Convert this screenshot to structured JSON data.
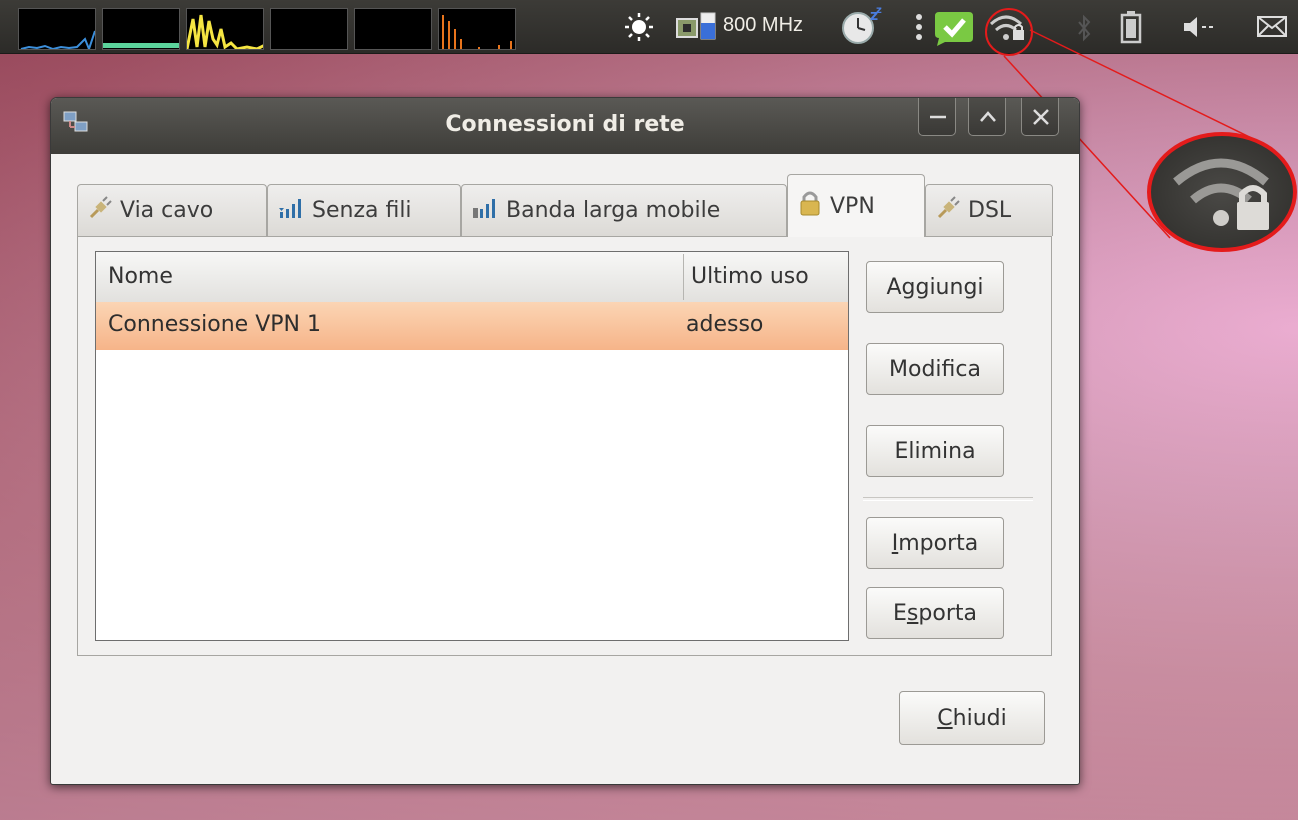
{
  "panel": {
    "cpu_frequency": "800 MHz",
    "system_monitor_graphs": [
      "network-graph",
      "memory-graph",
      "cpu-graph",
      "disk-graph",
      "swap-graph",
      "load-graph"
    ],
    "indicators": [
      "brightness-icon",
      "cpu-freq-icon",
      "clock-sleep-icon",
      "menu-dots-icon",
      "messaging-check-icon",
      "wifi-lock-icon",
      "bluetooth-icon",
      "battery-icon",
      "volume-icon",
      "mail-icon"
    ]
  },
  "window": {
    "title": "Connessioni di rete",
    "tabs": [
      {
        "label": "Via cavo",
        "icon": "wired-plug-icon"
      },
      {
        "label": "Senza fili",
        "icon": "wireless-signal-icon"
      },
      {
        "label": "Banda larga mobile",
        "icon": "mobile-broadband-icon"
      },
      {
        "label": "VPN",
        "icon": "lock-icon",
        "active": true
      },
      {
        "label": "DSL",
        "icon": "dsl-plug-icon"
      }
    ],
    "table": {
      "columns": [
        "Nome",
        "Ultimo uso"
      ],
      "rows": [
        {
          "name": "Connessione VPN 1",
          "last_used": "adesso",
          "selected": true
        }
      ]
    },
    "buttons": {
      "add": "Aggiungi",
      "edit": "Modifica",
      "delete": "Elimina",
      "import_mnemonic": "I",
      "import_rest": "mporta",
      "export_first": "E",
      "export_mnemonic": "s",
      "export_rest": "porta",
      "close_mnemonic": "C",
      "close_rest": "hiudi"
    }
  },
  "colors": {
    "panel_bg": "#3c3b37",
    "selection": "#f6b489",
    "callout": "#e41b1b",
    "messaging_green": "#7ac943"
  }
}
